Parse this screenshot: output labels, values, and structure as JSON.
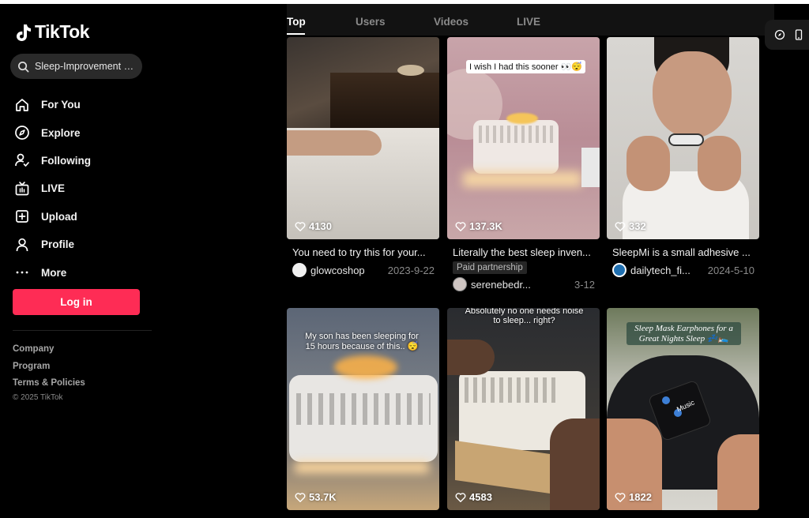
{
  "app": {
    "logo_text": "TikTok"
  },
  "search": {
    "value": "Sleep-Improvement G..."
  },
  "nav": [
    {
      "label": "For You",
      "icon": "home-icon"
    },
    {
      "label": "Explore",
      "icon": "compass-icon"
    },
    {
      "label": "Following",
      "icon": "following-icon"
    },
    {
      "label": "LIVE",
      "icon": "live-tv-icon"
    },
    {
      "label": "Upload",
      "icon": "upload-icon"
    },
    {
      "label": "Profile",
      "icon": "profile-icon"
    },
    {
      "label": "More",
      "icon": "more-dots-icon"
    }
  ],
  "login_label": "Log in",
  "footer": {
    "links": [
      "Company",
      "Program",
      "Terms & Policies"
    ],
    "copyright": "© 2025 TikTok"
  },
  "tabs": [
    "Top",
    "Users",
    "Videos",
    "LIVE"
  ],
  "videos": [
    {
      "likes": "4130",
      "desc": "You need to try this for your...",
      "author": "glowcoshop",
      "date": "2023-9-22",
      "tag": "",
      "overlay": ""
    },
    {
      "likes": "137.3K",
      "desc": "Literally the best sleep inven...",
      "author": "serenebedr...",
      "date": "3-12",
      "tag": "Paid partnership",
      "overlay": "I wish I had this sooner 👀😴"
    },
    {
      "likes": "332",
      "desc": "SleepMi is a small adhesive ...",
      "author": "dailytech_fi...",
      "date": "2024-5-10",
      "tag": "",
      "overlay": ""
    },
    {
      "likes": "53.7K",
      "desc": "",
      "author": "",
      "date": "",
      "tag": "",
      "overlay": "My son has been sleeping for 15 hours because of this.. 😴"
    },
    {
      "likes": "4583",
      "desc": "",
      "author": "",
      "date": "",
      "tag": "",
      "overlay": "Absolutely no one needs noise to sleep... right?"
    },
    {
      "likes": "1822",
      "desc": "",
      "author": "",
      "date": "",
      "tag": "",
      "overlay": "Sleep Mask Earphones for a Great Nights Sleep 💤🛌",
      "overlay2": "Music"
    }
  ]
}
